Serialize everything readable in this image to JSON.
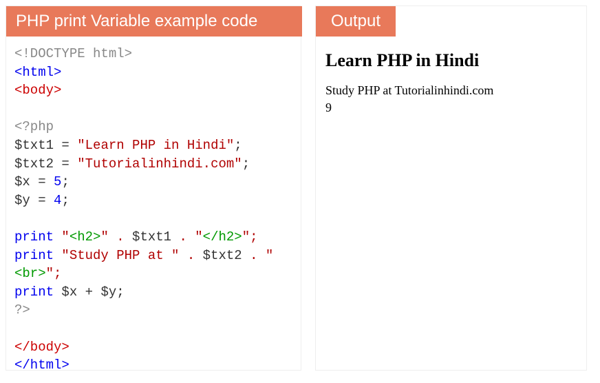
{
  "left": {
    "title": "PHP print Variable example code",
    "code": {
      "l1_doctype": "<!DOCTYPE html>",
      "l2_html_open": "<html>",
      "l3_body_open": "<body>",
      "l5_php_open": "<?php",
      "l6_var1": "$txt1",
      "l6_eq": " = ",
      "l6_str": "\"Learn PHP in Hindi\"",
      "l6_semi": ";",
      "l7_var2": "$txt2",
      "l7_eq": " = ",
      "l7_str": "\"Tutorialinhindi.com\"",
      "l7_semi": ";",
      "l8_var": "$x",
      "l8_eq": " = ",
      "l8_num": "5",
      "l8_semi": ";",
      "l9_var": "$y",
      "l9_eq": " = ",
      "l9_num": "4",
      "l9_semi": ";",
      "l11_print": "print",
      "l11_str1": " \"",
      "l11_tag1": "<h2>",
      "l11_str2": "\" . ",
      "l11_var": "$txt1",
      "l11_str3": " . \"",
      "l11_tag2": "</h2>",
      "l11_semi": "\";",
      "l12_print": "print",
      "l12_str1": " \"Study PHP at \" . ",
      "l12_var": "$txt2",
      "l12_str2": " . \"",
      "l12_tag": "<br>",
      "l12_semi": "\";",
      "l13_print": "print",
      "l13_sp": " ",
      "l13_v1": "$x",
      "l13_op": " + ",
      "l13_v2": "$y",
      "l13_semi": ";",
      "l14_php_close": "?>",
      "l16_body_close": "</body>",
      "l17_html_close": "</html>"
    }
  },
  "right": {
    "title": "Output",
    "heading": "Learn PHP in Hindi",
    "line1": "Study PHP at Tutorialinhindi.com",
    "line2": "9"
  },
  "chart_data": {
    "type": "table",
    "description": "PHP code example with its rendered output",
    "input_variables": {
      "txt1": "Learn PHP in Hindi",
      "txt2": "Tutorialinhindi.com",
      "x": 5,
      "y": 4
    },
    "output_lines": [
      "Learn PHP in Hindi",
      "Study PHP at Tutorialinhindi.com",
      "9"
    ]
  }
}
